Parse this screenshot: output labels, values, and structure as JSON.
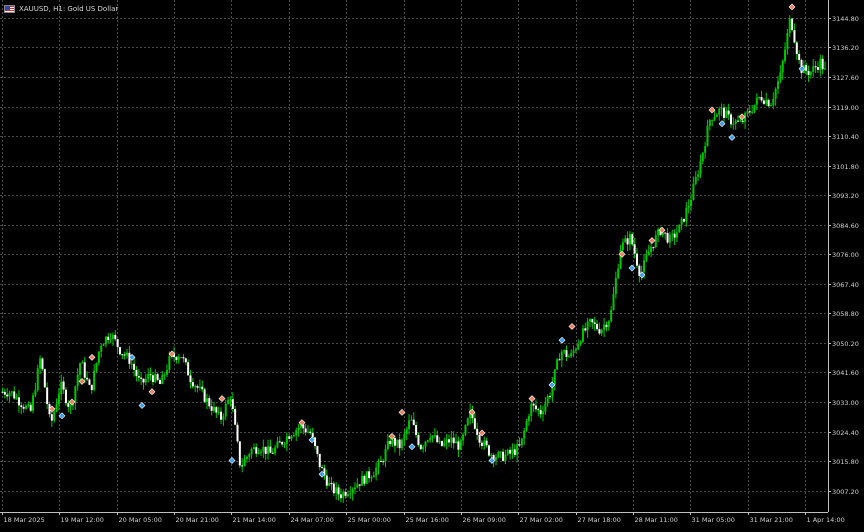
{
  "header": {
    "flag_icon": "us-flag-icon",
    "symbol_label": "XAUUSD, H1:  Gold US Dollar"
  },
  "colors": {
    "background": "#000000",
    "grid": "#4a4a4a",
    "axis_text": "#d0d0d0",
    "bull_candle": "#00c800",
    "bear_candle": "#ffffff",
    "wick": "#00c800",
    "sell_marker": "#f08060",
    "buy_marker": "#3a9ff0",
    "axis_line": "#bfbfbf"
  },
  "chart_data": {
    "type": "candlestick",
    "symbol": "XAUUSD",
    "timeframe": "H1",
    "title": "XAUUSD, H1:  Gold US Dollar",
    "ylim": [
      3001.0,
      3150.0
    ],
    "y_ticks": [
      "3144.80",
      "3136.20",
      "3127.60",
      "3119.00",
      "3110.40",
      "3101.80",
      "3093.20",
      "3084.60",
      "3076.00",
      "3067.40",
      "3058.80",
      "3050.20",
      "3041.60",
      "3033.00",
      "3024.40",
      "3015.80",
      "3007.20"
    ],
    "x_ticks": [
      "18 Mar 2025",
      "19 Mar 12:00",
      "20 Mar 05:00",
      "20 Mar 21:00",
      "21 Mar 14:00",
      "24 Mar 07:00",
      "25 Mar 00:00",
      "25 Mar 16:00",
      "26 Mar 09:00",
      "27 Mar 02:00",
      "27 Mar 18:00",
      "28 Mar 11:00",
      "31 Mar 05:00",
      "31 Mar 21:00",
      "1 Apr 14:00"
    ],
    "grid": true,
    "close_path": [
      [
        0,
        3036
      ],
      [
        10,
        3036
      ],
      [
        20,
        3033
      ],
      [
        30,
        3030
      ],
      [
        40,
        3046
      ],
      [
        50,
        3026
      ],
      [
        60,
        3038
      ],
      [
        70,
        3031
      ],
      [
        80,
        3045
      ],
      [
        90,
        3036
      ],
      [
        100,
        3050
      ],
      [
        110,
        3053
      ],
      [
        120,
        3048
      ],
      [
        130,
        3045
      ],
      [
        140,
        3038
      ],
      [
        150,
        3041
      ],
      [
        160,
        3038
      ],
      [
        170,
        3046
      ],
      [
        180,
        3047
      ],
      [
        190,
        3040
      ],
      [
        200,
        3036
      ],
      [
        210,
        3032
      ],
      [
        220,
        3028
      ],
      [
        230,
        3035
      ],
      [
        240,
        3014
      ],
      [
        250,
        3019
      ],
      [
        260,
        3020
      ],
      [
        270,
        3018
      ],
      [
        280,
        3021
      ],
      [
        290,
        3024
      ],
      [
        300,
        3026
      ],
      [
        310,
        3024
      ],
      [
        320,
        3014
      ],
      [
        330,
        3008
      ],
      [
        340,
        3006
      ],
      [
        350,
        3008
      ],
      [
        360,
        3010
      ],
      [
        370,
        3012
      ],
      [
        380,
        3015
      ],
      [
        390,
        3022
      ],
      [
        400,
        3020
      ],
      [
        410,
        3028
      ],
      [
        420,
        3020
      ],
      [
        430,
        3024
      ],
      [
        440,
        3020
      ],
      [
        450,
        3022
      ],
      [
        460,
        3020
      ],
      [
        470,
        3030
      ],
      [
        480,
        3022
      ],
      [
        490,
        3018
      ],
      [
        500,
        3017
      ],
      [
        510,
        3018
      ],
      [
        520,
        3020
      ],
      [
        530,
        3032
      ],
      [
        540,
        3030
      ],
      [
        550,
        3036
      ],
      [
        560,
        3048
      ],
      [
        570,
        3046
      ],
      [
        580,
        3052
      ],
      [
        590,
        3056
      ],
      [
        600,
        3054
      ],
      [
        610,
        3058
      ],
      [
        620,
        3078
      ],
      [
        630,
        3081
      ],
      [
        640,
        3070
      ],
      [
        650,
        3078
      ],
      [
        660,
        3083
      ],
      [
        670,
        3080
      ],
      [
        680,
        3084
      ],
      [
        690,
        3092
      ],
      [
        700,
        3103
      ],
      [
        710,
        3116
      ],
      [
        720,
        3118
      ],
      [
        730,
        3115
      ],
      [
        740,
        3114
      ],
      [
        750,
        3118
      ],
      [
        760,
        3122
      ],
      [
        770,
        3120
      ],
      [
        780,
        3128
      ],
      [
        790,
        3145
      ],
      [
        800,
        3130
      ],
      [
        810,
        3129
      ],
      [
        820,
        3132
      ],
      [
        828,
        3127
      ]
    ],
    "trade_markers": [
      {
        "time_index": 5,
        "price": 3031,
        "type": "sell"
      },
      {
        "time_index": 6,
        "price": 3029,
        "type": "buy"
      },
      {
        "time_index": 7,
        "price": 3033,
        "type": "sell"
      },
      {
        "time_index": 8,
        "price": 3039,
        "type": "sell"
      },
      {
        "time_index": 9,
        "price": 3046,
        "type": "sell"
      },
      {
        "time_index": 13,
        "price": 3046,
        "type": "buy"
      },
      {
        "time_index": 14,
        "price": 3032,
        "type": "buy"
      },
      {
        "time_index": 15,
        "price": 3036,
        "type": "sell"
      },
      {
        "time_index": 17,
        "price": 3047,
        "type": "sell"
      },
      {
        "time_index": 22,
        "price": 3034,
        "type": "sell"
      },
      {
        "time_index": 23,
        "price": 3016,
        "type": "buy"
      },
      {
        "time_index": 30,
        "price": 3027,
        "type": "sell"
      },
      {
        "time_index": 31,
        "price": 3022,
        "type": "buy"
      },
      {
        "time_index": 32,
        "price": 3012,
        "type": "buy"
      },
      {
        "time_index": 39,
        "price": 3023,
        "type": "sell"
      },
      {
        "time_index": 40,
        "price": 3030,
        "type": "sell"
      },
      {
        "time_index": 41,
        "price": 3020,
        "type": "buy"
      },
      {
        "time_index": 47,
        "price": 3030,
        "type": "sell"
      },
      {
        "time_index": 48,
        "price": 3024,
        "type": "sell"
      },
      {
        "time_index": 49,
        "price": 3016,
        "type": "buy"
      },
      {
        "time_index": 53,
        "price": 3034,
        "type": "sell"
      },
      {
        "time_index": 55,
        "price": 3038,
        "type": "buy"
      },
      {
        "time_index": 56,
        "price": 3051,
        "type": "buy"
      },
      {
        "time_index": 57,
        "price": 3055,
        "type": "sell"
      },
      {
        "time_index": 62,
        "price": 3076,
        "type": "sell"
      },
      {
        "time_index": 63,
        "price": 3072,
        "type": "buy"
      },
      {
        "time_index": 64,
        "price": 3070,
        "type": "buy"
      },
      {
        "time_index": 65,
        "price": 3080,
        "type": "sell"
      },
      {
        "time_index": 66,
        "price": 3083,
        "type": "sell"
      },
      {
        "time_index": 71,
        "price": 3118,
        "type": "sell"
      },
      {
        "time_index": 72,
        "price": 3114,
        "type": "buy"
      },
      {
        "time_index": 73,
        "price": 3110,
        "type": "buy"
      },
      {
        "time_index": 74,
        "price": 3116,
        "type": "sell"
      },
      {
        "time_index": 79,
        "price": 3148,
        "type": "sell"
      },
      {
        "time_index": 80,
        "price": 3130,
        "type": "buy"
      }
    ]
  }
}
